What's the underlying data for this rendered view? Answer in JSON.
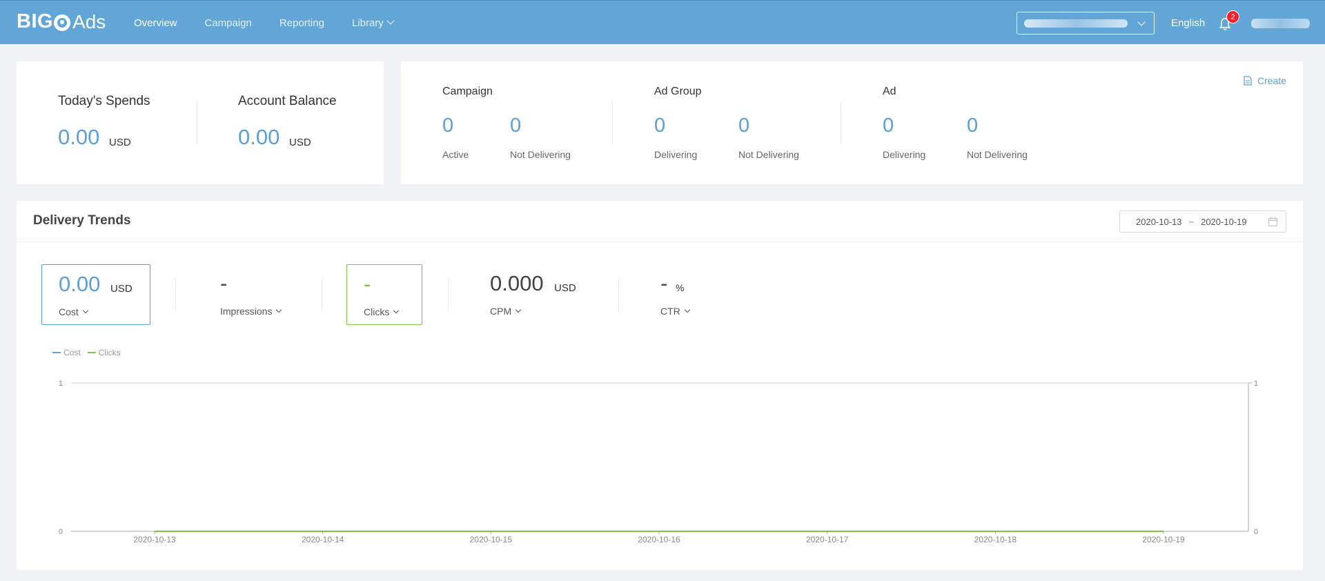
{
  "brand": {
    "bold": "BIG",
    "light": "Ads"
  },
  "nav": {
    "items": [
      {
        "label": "Overview",
        "active": true
      },
      {
        "label": "Campaign"
      },
      {
        "label": "Reporting"
      },
      {
        "label": "Library"
      }
    ]
  },
  "header": {
    "language": "English",
    "notification_count": "2"
  },
  "spend": {
    "today_title": "Today's Spends",
    "today_value": "0.00",
    "today_unit": "USD",
    "balance_title": "Account Balance",
    "balance_value": "0.00",
    "balance_unit": "USD"
  },
  "status": {
    "create_label": "Create",
    "campaign": {
      "title": "Campaign",
      "a_value": "0",
      "a_label": "Active",
      "b_value": "0",
      "b_label": "Not Delivering"
    },
    "adgroup": {
      "title": "Ad Group",
      "a_value": "0",
      "a_label": "Delivering",
      "b_value": "0",
      "b_label": "Not Delivering"
    },
    "ad": {
      "title": "Ad",
      "a_value": "0",
      "a_label": "Delivering",
      "b_value": "0",
      "b_label": "Not Delivering"
    }
  },
  "trends": {
    "title": "Delivery Trends",
    "date_start": "2020-10-13",
    "date_sep": "~",
    "date_end": "2020-10-19",
    "metrics": [
      {
        "value": "0.00",
        "unit": "USD",
        "label": "Cost"
      },
      {
        "value": "-",
        "unit": "",
        "label": "Impressions"
      },
      {
        "value": "-",
        "unit": "",
        "label": "Clicks"
      },
      {
        "value": "0.000",
        "unit": "USD",
        "label": "CPM"
      },
      {
        "value": "-",
        "unit": "%",
        "label": "CTR"
      }
    ]
  },
  "colors": {
    "accent": "#5b9fd6",
    "nav_bg": "#62a6d8",
    "clicks": "#7dc242",
    "badge": "#f5222d"
  },
  "chart_data": {
    "type": "line",
    "x": [
      "2020-10-13",
      "2020-10-14",
      "2020-10-15",
      "2020-10-16",
      "2020-10-17",
      "2020-10-18",
      "2020-10-19"
    ],
    "series": [
      {
        "name": "Cost",
        "color": "#5b9fd6",
        "axis": "left",
        "values": [
          0,
          0,
          0,
          0,
          0,
          0,
          0
        ]
      },
      {
        "name": "Clicks",
        "color": "#7dc242",
        "axis": "right",
        "values": [
          0,
          0,
          0,
          0,
          0,
          0,
          0
        ]
      }
    ],
    "ylim_left": [
      0,
      1
    ],
    "ylim_right": [
      0,
      1
    ],
    "yticks_left": [
      "0",
      "1"
    ],
    "yticks_right": [
      "0",
      "1"
    ],
    "legend_position": "top-left",
    "grid": "horizontal-top-only"
  }
}
